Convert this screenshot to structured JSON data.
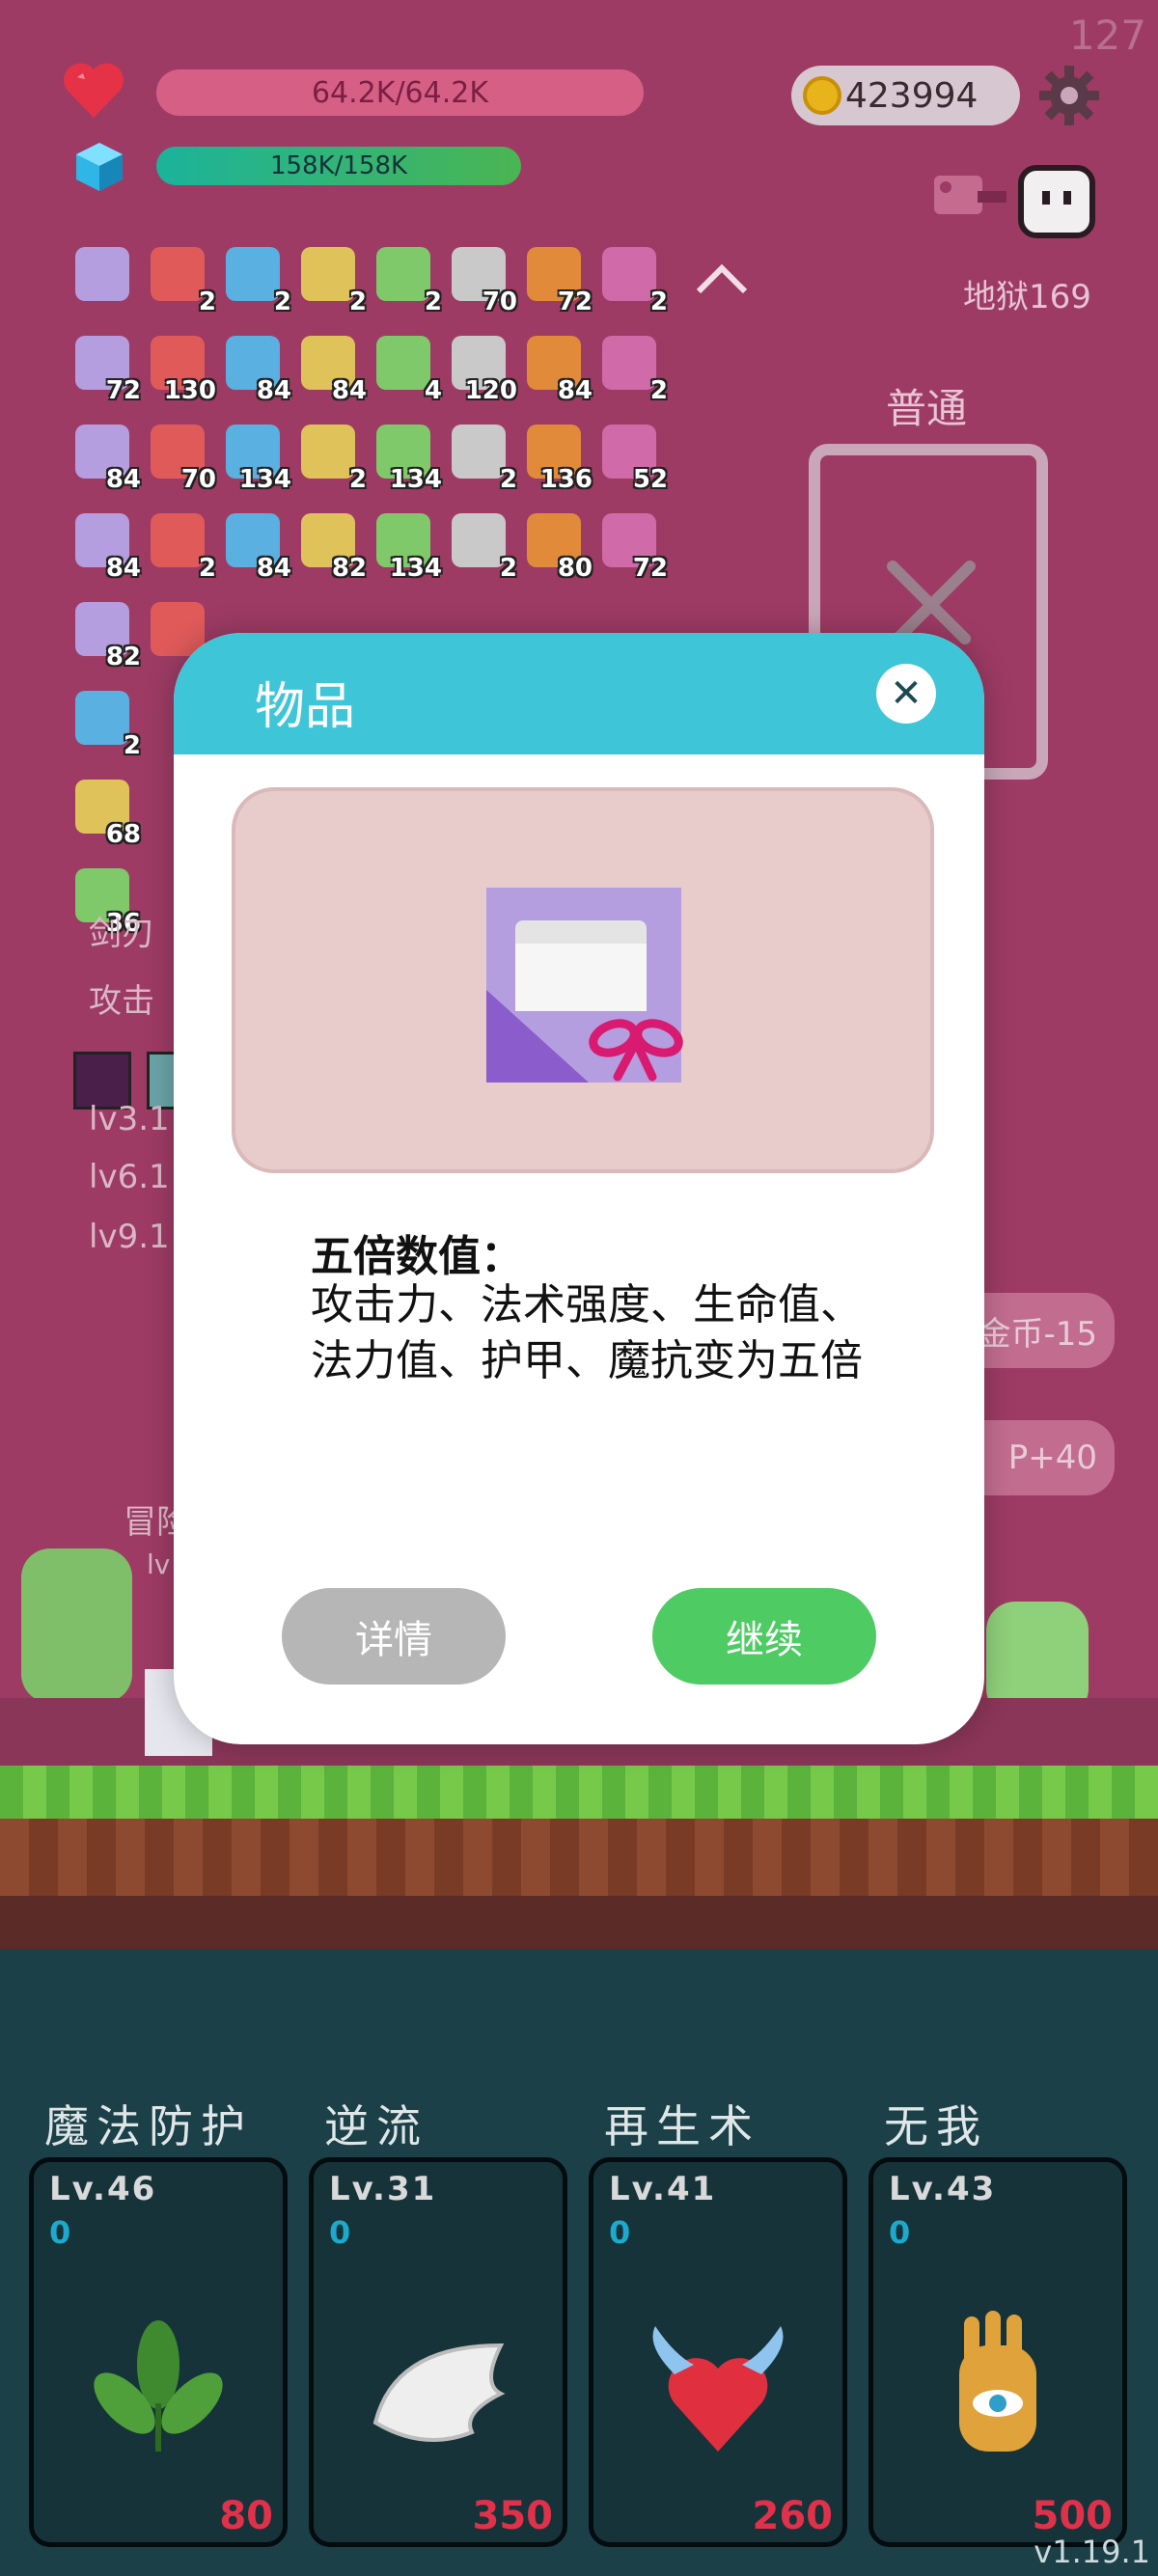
{
  "fps": "127",
  "player": {
    "hp": "64.2K/64.2K",
    "mp": "158K/158K",
    "coins": "423994"
  },
  "stage_label": "地狱169",
  "mode_label": "普通",
  "inventory": [
    {
      "icon": "scroll-ribbon-icon",
      "count": ""
    },
    {
      "icon": "scroll-ribbon-icon",
      "count": "2"
    },
    {
      "icon": "scroll-ribbon-icon",
      "count": "2"
    },
    {
      "icon": "star-card-icon",
      "count": "2"
    },
    {
      "icon": "robe-icon",
      "count": "2"
    },
    {
      "icon": "cloud-icon",
      "count": "70"
    },
    {
      "icon": "sunflower-icon",
      "count": "72"
    },
    {
      "icon": "lemon-icon",
      "count": "2"
    },
    {
      "icon": "envelope-icon",
      "count": "72"
    },
    {
      "icon": "flag-icon",
      "count": "130"
    },
    {
      "icon": "flower-icon",
      "count": "84"
    },
    {
      "icon": "coins-stack-icon",
      "count": "84"
    },
    {
      "icon": "scroll-icon",
      "count": "4"
    },
    {
      "icon": "ghost-icon",
      "count": "120"
    },
    {
      "icon": "bomb-icon",
      "count": "84"
    },
    {
      "icon": "playing-card-icon",
      "count": "2"
    },
    {
      "icon": "sock-icon",
      "count": "84"
    },
    {
      "icon": "coconut-icon",
      "count": "70"
    },
    {
      "icon": "spiked-ball-icon",
      "count": "134"
    },
    {
      "icon": "beer-icon",
      "count": "2"
    },
    {
      "icon": "blue-slime-icon",
      "count": "134"
    },
    {
      "icon": "mortar-icon",
      "count": "2"
    },
    {
      "icon": "purple-flower-icon",
      "count": "136"
    },
    {
      "icon": "strawberry-icon",
      "count": "52"
    },
    {
      "icon": "watermelon-icon",
      "count": "84"
    },
    {
      "icon": "spiral-icon",
      "count": "2"
    },
    {
      "icon": "book-icon",
      "count": "84"
    },
    {
      "icon": "donut-icon",
      "count": "82"
    },
    {
      "icon": "ship-icon",
      "count": "134"
    },
    {
      "icon": "ice-cream-icon",
      "count": "2"
    },
    {
      "icon": "sword-icon",
      "count": "80"
    },
    {
      "icon": "red-banner-icon",
      "count": "72"
    },
    {
      "icon": "meat-icon",
      "count": "82"
    },
    {
      "icon": "crown-icon",
      "count": ""
    },
    {
      "icon": "shield-icon",
      "count": "2"
    },
    {
      "icon": "dice-icon",
      "count": "68"
    },
    {
      "icon": "bread-icon",
      "count": "36"
    }
  ],
  "background_text": {
    "line1": "剑刃",
    "line2": "攻击",
    "lv3": "lv3.1",
    "lv6": "lv6.1",
    "lv9": "lv9.1",
    "adventure": "冒险",
    "lvmini": "lv"
  },
  "side_buttons": {
    "coin_cost": "金币-15",
    "xp_gain": "P+40"
  },
  "modal": {
    "title": "物品",
    "close_symbol": "✕",
    "desc_title": "五倍数值：",
    "desc_body": "攻击力、法术强度、生命值、法力值、护甲、魔抗变为五倍",
    "detail_button": "详情",
    "continue_button": "继续"
  },
  "skills": [
    {
      "name": "魔法防护",
      "level": "Lv.46",
      "counter": "0",
      "cost": "80",
      "icon": "leaf-icon"
    },
    {
      "name": "逆流",
      "level": "Lv.31",
      "counter": "0",
      "cost": "350",
      "icon": "wing-icon"
    },
    {
      "name": "再生术",
      "level": "Lv.41",
      "counter": "0",
      "cost": "260",
      "icon": "winged-heart-icon"
    },
    {
      "name": "无我",
      "level": "Lv.43",
      "counter": "0",
      "cost": "500",
      "icon": "eye-hand-icon"
    }
  ],
  "version": "v1.19.1",
  "colors": {
    "background": "#9d3b64",
    "modal_header": "#3ec6d8",
    "continue": "#4fcb63",
    "detail": "#b6b6b6",
    "cost_red": "#e0314a"
  }
}
